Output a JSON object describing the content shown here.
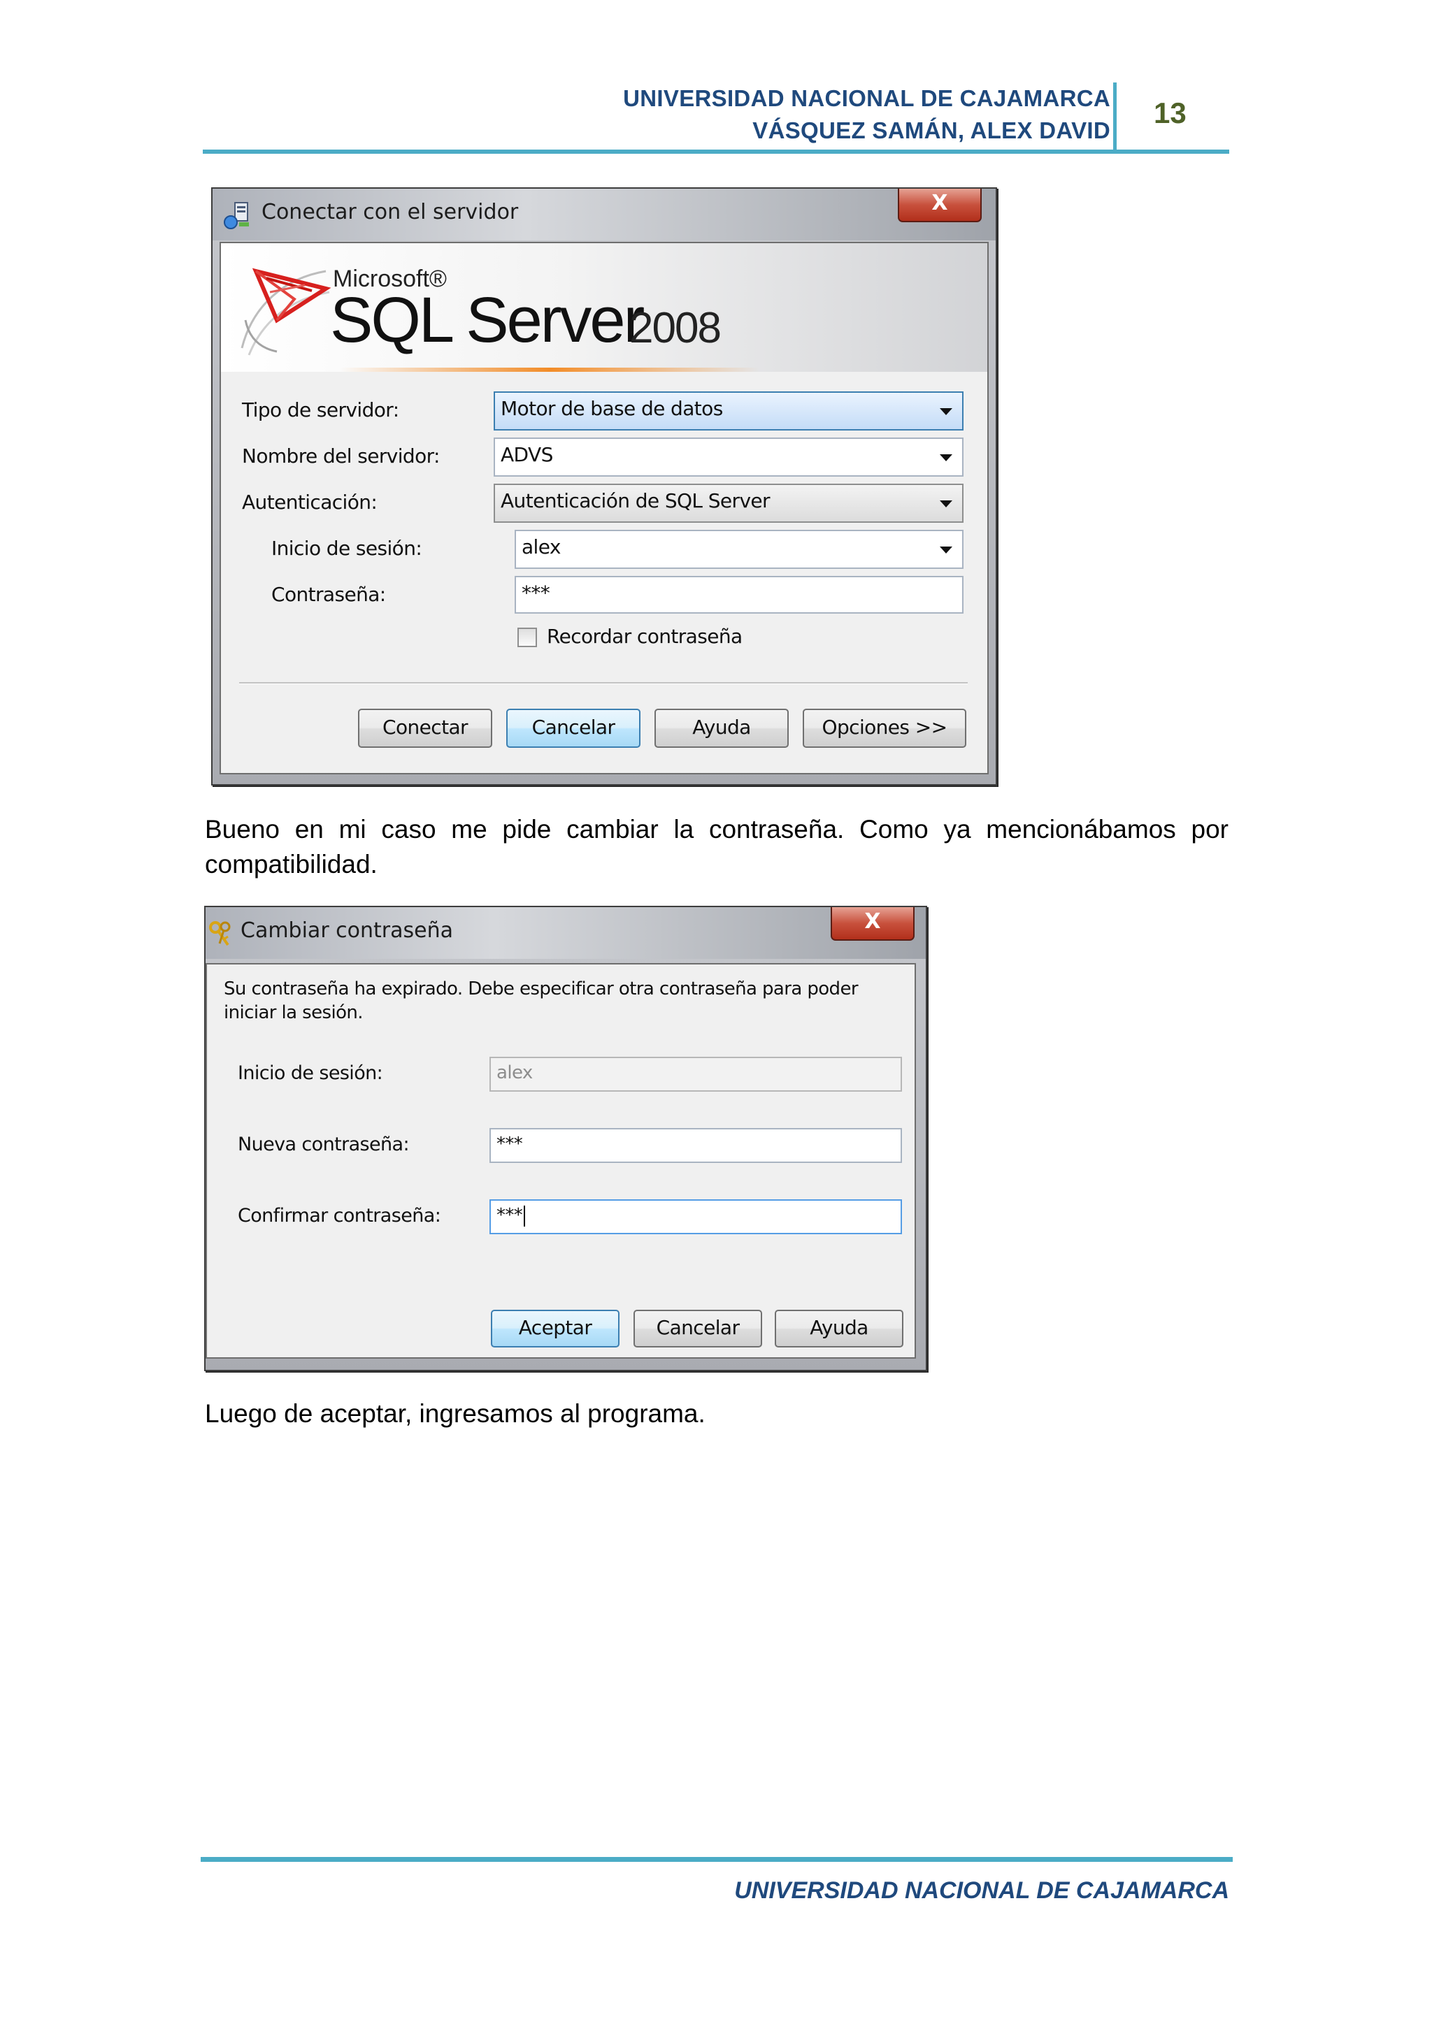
{
  "header": {
    "line1": "UNIVERSIDAD NACIONAL DE CAJAMARCA",
    "line2": "VÁSQUEZ SAMÁN, ALEX DAVID",
    "page_number": "13"
  },
  "connect_dialog": {
    "title": "Conectar con el servidor",
    "close": "X",
    "brand_vendor": "Microsoft®",
    "brand_product": "SQL Server",
    "brand_version": "2008",
    "fields": {
      "server_type_label": "Tipo de servidor:",
      "server_type_value": "Motor de base de datos",
      "server_name_label": "Nombre del servidor:",
      "server_name_value": "ADVS",
      "auth_label": "Autenticación:",
      "auth_value": "Autenticación de SQL Server",
      "login_label": "Inicio de sesión:",
      "login_value": "alex",
      "password_label": "Contraseña:",
      "password_value": "***"
    },
    "remember_label": "Recordar contraseña",
    "buttons": {
      "connect": "Conectar",
      "cancel": "Cancelar",
      "help": "Ayuda",
      "options": "Opciones >>"
    }
  },
  "paragraph1": "Bueno en mi caso me pide cambiar la contraseña. Como ya mencionábamos por compatibilidad.",
  "change_dialog": {
    "title": "Cambiar contraseña",
    "close": "X",
    "message": "Su contraseña ha expirado. Debe especificar otra contraseña para poder iniciar la sesión.",
    "login_label": "Inicio de sesión:",
    "login_value": "alex",
    "new_label": "Nueva contraseña:",
    "new_value": "***",
    "confirm_label": "Confirmar contraseña:",
    "confirm_value": "***",
    "buttons": {
      "accept": "Aceptar",
      "cancel": "Cancelar",
      "help": "Ayuda"
    }
  },
  "paragraph2": "Luego de aceptar, ingresamos al programa.",
  "footer": {
    "text": "UNIVERSIDAD NACIONAL DE CAJAMARCA"
  }
}
